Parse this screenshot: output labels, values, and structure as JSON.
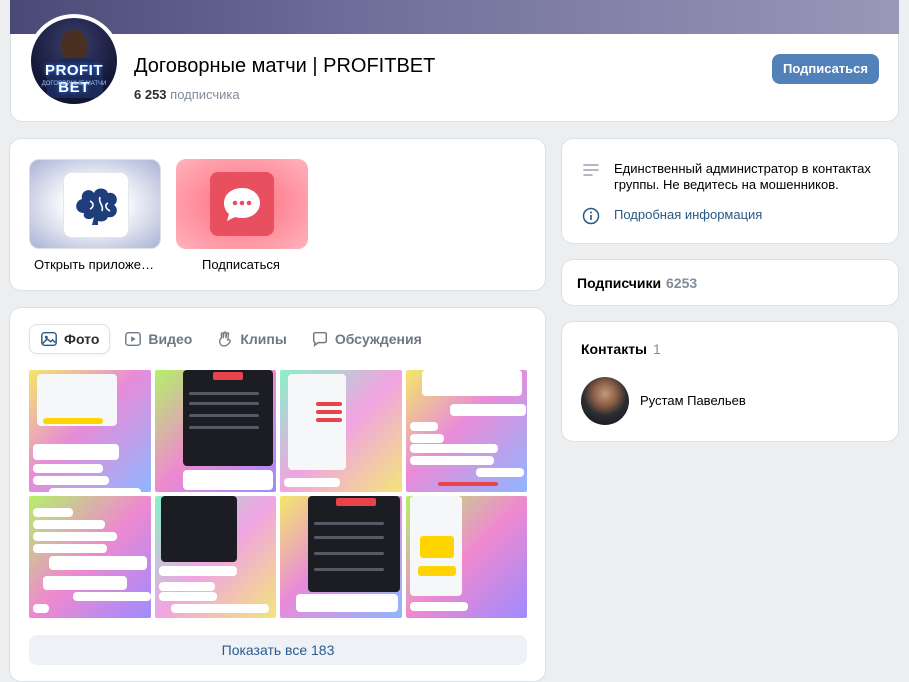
{
  "header": {
    "title": "Договорные матчи | PROFITBET",
    "subscribers_count": "6 253",
    "subscribers_label": "подписчика",
    "subscribe_button": "Подписаться",
    "avatar_text": "PROFIT BET",
    "avatar_subtext": "ДОГОВОРНЫЕ МАТЧИ"
  },
  "apps": [
    {
      "label": "Открыть приложе…",
      "icon": "brain-icon"
    },
    {
      "label": "Подписаться",
      "icon": "chat-bubble-icon"
    }
  ],
  "media": {
    "tabs": [
      {
        "label": "Фото",
        "icon": "photo-icon",
        "active": true
      },
      {
        "label": "Видео",
        "icon": "video-icon",
        "active": false
      },
      {
        "label": "Клипы",
        "icon": "clips-icon",
        "active": false
      },
      {
        "label": "Обсуждения",
        "icon": "discussion-icon",
        "active": false
      }
    ],
    "show_all": "Показать все 183"
  },
  "info": {
    "description": "Единственный администратор в контактах группы. Не ведитесь на мошенников.",
    "more_link": "Подробная информация"
  },
  "subscribers": {
    "label": "Подписчики",
    "count": "6253"
  },
  "contacts": {
    "label": "Контакты",
    "count": "1",
    "person_name": "Рустам Павельев"
  },
  "colors": {
    "accent": "#5181b8",
    "link": "#2a5885",
    "background": "#edeef0"
  }
}
